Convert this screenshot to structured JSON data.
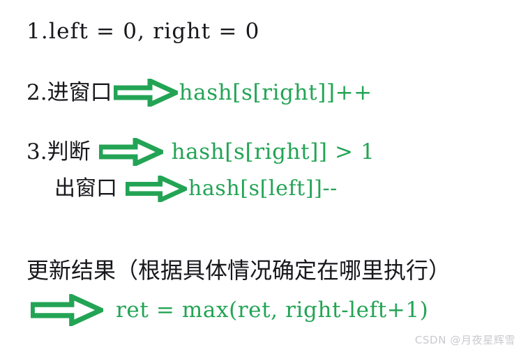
{
  "document": {
    "background_color": "#ffffff",
    "text_color": "#17171c",
    "accent_color": "#23a455"
  },
  "steps": [
    {
      "number": "1.",
      "label": "left = 0, right = 0",
      "arrow": false,
      "code": ""
    },
    {
      "number": "2.",
      "label": "进窗口",
      "arrow": true,
      "arrow_icon": "right-block-arrow-icon",
      "code": "hash[s[right]]++"
    },
    {
      "number": "3.",
      "label": "判断",
      "arrow": true,
      "arrow_icon": "right-block-arrow-icon",
      "code": "hash[s[right]] > 1"
    },
    {
      "number": "",
      "label": "出窗口",
      "arrow": true,
      "arrow_icon": "right-block-arrow-icon",
      "code": "hash[s[left]]--"
    }
  ],
  "result_section": {
    "heading": "更新结果（根据具体情况确定在哪里执行）",
    "arrow_icon": "right-block-arrow-icon",
    "code": "ret = max(ret, right-left+1)"
  },
  "watermark": {
    "text": "CSDN @月夜星辉雪"
  }
}
